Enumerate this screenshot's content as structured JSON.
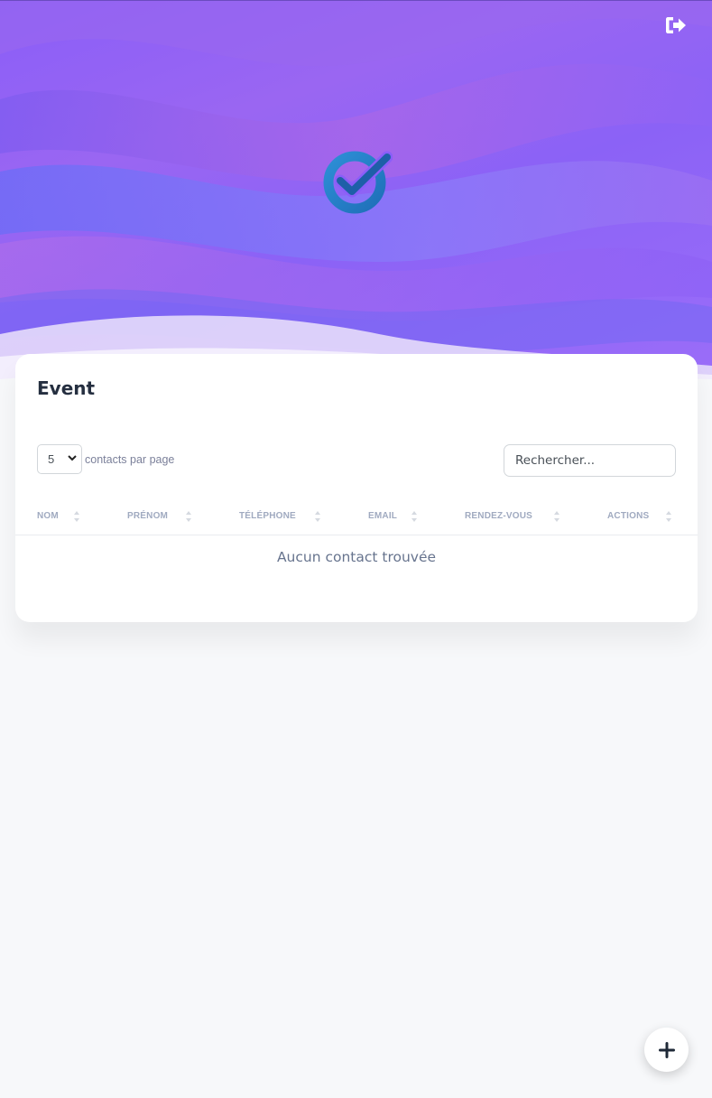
{
  "header": {
    "logout_icon": "sign-out-icon",
    "logo_icon": "check-circle-logo"
  },
  "card": {
    "title": "Event",
    "per_page": {
      "value": "5",
      "label": "contacts par page"
    },
    "search": {
      "placeholder": "Rechercher..."
    },
    "table": {
      "columns": [
        "NOM",
        "PRÉNOM",
        "TÉLÉPHONE",
        "EMAIL",
        "RENDEZ-VOUS",
        "ACTIONS"
      ],
      "empty_message": "Aucun contact trouvée"
    }
  },
  "fab": {
    "icon": "plus-icon"
  },
  "colors": {
    "hero": "#8a5ef8",
    "title": "#252f40",
    "muted": "#a0aac0"
  }
}
